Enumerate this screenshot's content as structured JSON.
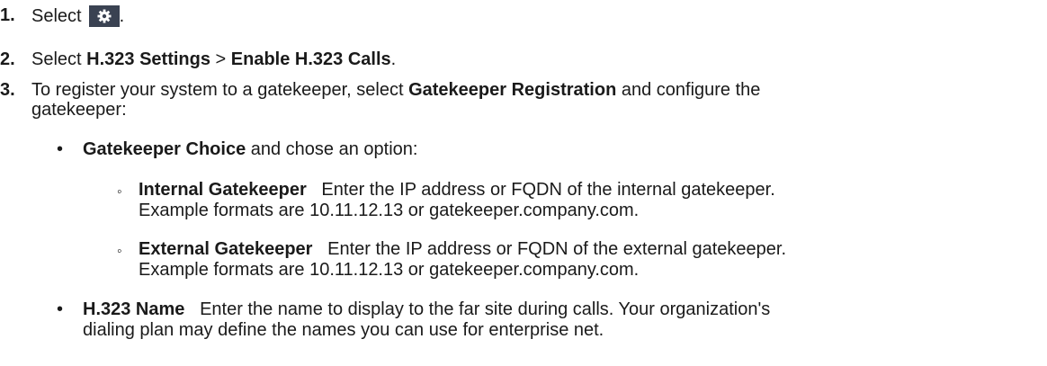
{
  "steps": [
    {
      "number": "1.",
      "parts": [
        "Select",
        "."
      ],
      "icon": "gear-icon"
    },
    {
      "number": "2.",
      "parts": [
        "Select ",
        "H.323 Settings",
        " > ",
        "Enable H.323 Calls",
        "."
      ]
    },
    {
      "number": "3.",
      "line1": [
        "To register your system to a gatekeeper, select ",
        "Gatekeeper Registration",
        " and configure the"
      ],
      "line2": "gatekeeper:"
    }
  ],
  "bullets": [
    {
      "marker": "•",
      "bold": "Gatekeeper Choice",
      "text": " and chose an option:"
    },
    {
      "marker": "•",
      "bold": "H.323 Name",
      "text": "   Enter the name to display to the far site during calls. Your organization's",
      "line2": "dialing plan may define the names you can use for enterprise net."
    }
  ],
  "subbullets": [
    {
      "marker": "◦",
      "bold": "Internal Gatekeeper",
      "text": "   Enter the IP address or FQDN of the internal gatekeeper.",
      "line2": "Example formats are 10.11.12.13 or gatekeeper.company.com."
    },
    {
      "marker": "◦",
      "bold": "External Gatekeeper",
      "text": "   Enter the IP address or FQDN of the external gatekeeper.",
      "line2": "Example formats are 10.11.12.13 or gatekeeper.company.com."
    }
  ],
  "colors": {
    "text": "#1a1a1a",
    "icon_bg": "#3a4252",
    "icon_fg": "#ffffff"
  }
}
